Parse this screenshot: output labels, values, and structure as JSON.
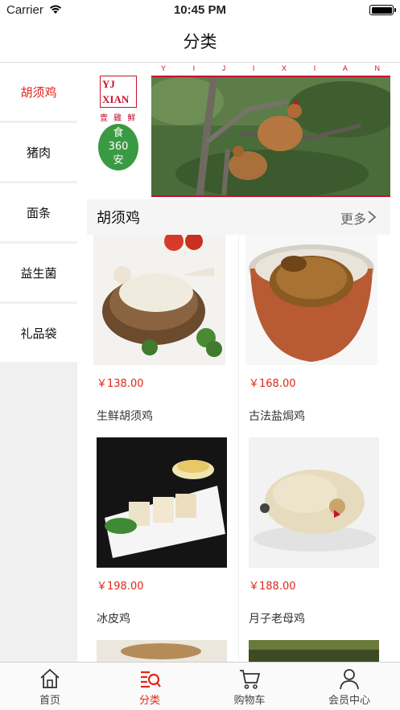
{
  "status_bar": {
    "carrier": "Carrier",
    "time": "10:45 PM"
  },
  "nav": {
    "title": "分类"
  },
  "sidebar": {
    "items": [
      {
        "label": "胡须鸡",
        "active": true
      },
      {
        "label": "猪肉",
        "active": false
      },
      {
        "label": "面条",
        "active": false
      },
      {
        "label": "益生菌",
        "active": false
      },
      {
        "label": "礼品袋",
        "active": false
      }
    ]
  },
  "banner": {
    "letters": [
      "Y",
      "I",
      "J",
      "I",
      "X",
      "I",
      "A",
      "N"
    ],
    "logo_mark_lines": [
      "YJ",
      "XIAN"
    ],
    "logo_cn": "壹 雞 鮮",
    "badge_line1": "食",
    "badge_line2": "360",
    "badge_line3": "安"
  },
  "section": {
    "title": "胡须鸡",
    "more_label": "更多"
  },
  "products": [
    {
      "price": "￥138.00",
      "name": "生鲜胡须鸡"
    },
    {
      "price": "￥168.00",
      "name": "古法盐焗鸡"
    },
    {
      "price": "￥198.00",
      "name": "冰皮鸡"
    },
    {
      "price": "￥188.00",
      "name": "月子老母鸡"
    }
  ],
  "tabbar": {
    "items": [
      {
        "label": "首页",
        "icon": "home-icon",
        "active": false
      },
      {
        "label": "分类",
        "icon": "category-icon",
        "active": true
      },
      {
        "label": "购物车",
        "icon": "cart-icon",
        "active": false
      },
      {
        "label": "会员中心",
        "icon": "user-icon",
        "active": false
      }
    ]
  },
  "colors": {
    "accent": "#e0261a",
    "brand_red": "#c8102e",
    "brand_green": "#3a9a43"
  }
}
